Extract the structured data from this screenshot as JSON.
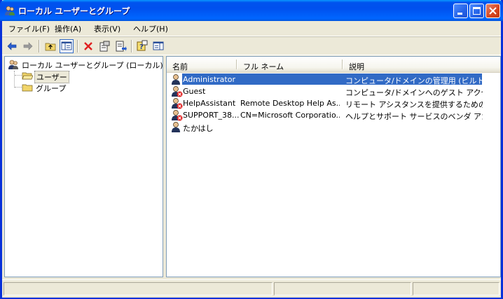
{
  "window": {
    "title": "ローカル ユーザーとグループ"
  },
  "menu": [
    "ファイル(F)",
    "操作(A)",
    "表示(V)",
    "ヘルプ(H)"
  ],
  "toolbar": {
    "icons": [
      "back-arrow-icon",
      "forward-arrow-icon",
      "up-folder-icon",
      "show-tree-icon",
      "delete-icon",
      "properties-icon",
      "export-list-icon",
      "help-icon",
      "show-action-pane-icon"
    ]
  },
  "tree": {
    "root": "ローカル ユーザーとグループ (ローカル)",
    "users": "ユーザー",
    "groups": "グループ"
  },
  "list": {
    "columns": [
      "名前",
      "フル ネーム",
      "説明"
    ],
    "rows": [
      {
        "name": "Administrator",
        "full": "",
        "desc": "コンピュータ/ドメインの管理用 (ビルトイ...",
        "disabled": false
      },
      {
        "name": "Guest",
        "full": "",
        "desc": "コンピュータ/ドメインへのゲスト アクセス...",
        "disabled": true
      },
      {
        "name": "HelpAssistant",
        "full": "Remote Desktop Help As...",
        "desc": "リモート アシスタンスを提供するためのア...",
        "disabled": true
      },
      {
        "name": "SUPPORT_38...",
        "full": "CN=Microsoft Corporatio...",
        "desc": "ヘルプとサポート サービスのベンダ アカ...",
        "disabled": true
      },
      {
        "name": "たかはし",
        "full": "",
        "desc": "",
        "disabled": false
      }
    ],
    "selected_row": 0
  },
  "colors": {
    "title_blue": "#0054E3",
    "selection": "#316AC5"
  }
}
